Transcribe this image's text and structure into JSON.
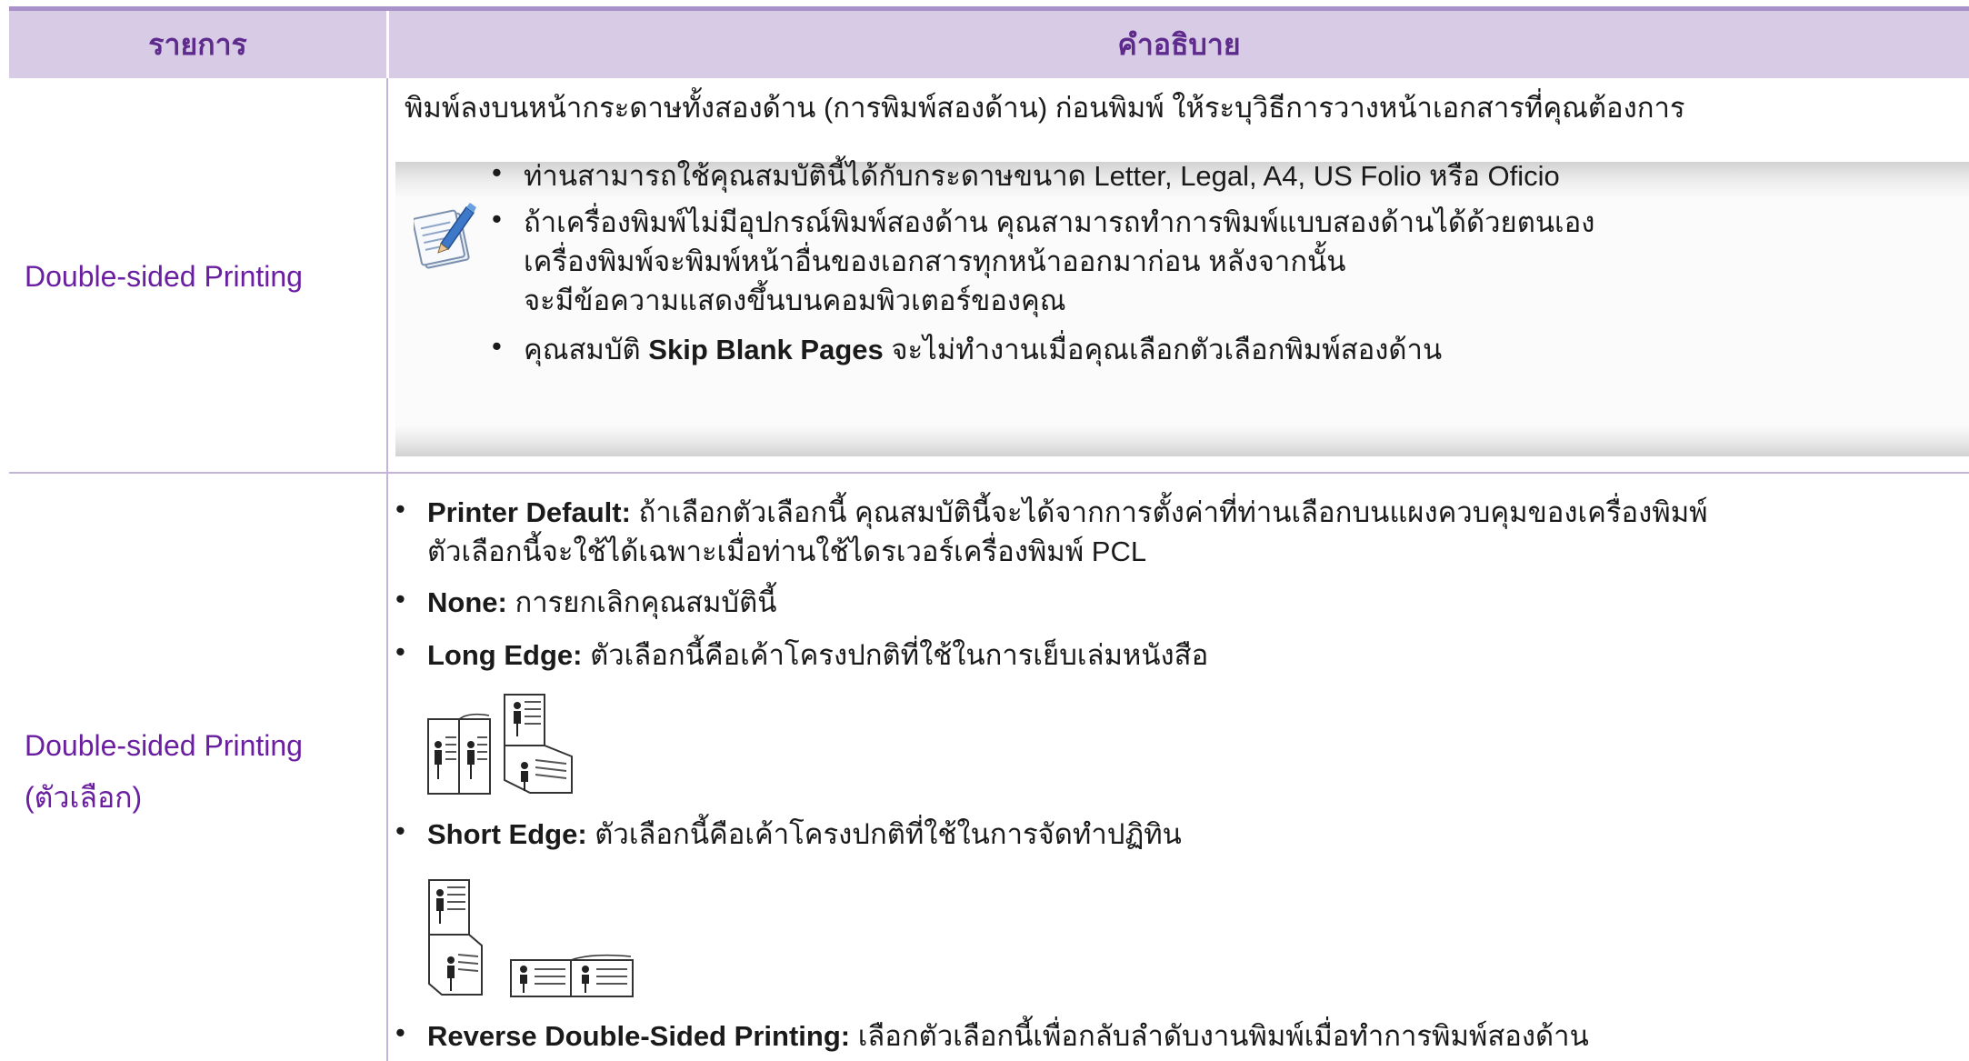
{
  "header": {
    "col1": "รายการ",
    "col2": "คำอธิบาย"
  },
  "row1": {
    "label": "Double-sided Printing",
    "intro": "พิมพ์ลงบนหน้ากระดาษทั้งสองด้าน (การพิมพ์สองด้าน) ก่อนพิมพ์ ให้ระบุวิธีการวางหน้าเอกสารที่คุณต้องการ",
    "note": {
      "icon": "note-pencil-icon",
      "items": [
        "ท่านสามารถใช้คุณสมบัตินี้ได้กับกระดาษขนาด Letter, Legal, A4, US Folio หรือ Oficio",
        "ถ้าเครื่องพิมพ์ไม่มีอุปกรณ์พิมพ์สองด้าน คุณสามารถทำการพิมพ์แบบสองด้านได้ด้วยตนเอง",
        "เครื่องพิมพ์จะพิมพ์หน้าอื่นของเอกสารทุกหน้าออกมาก่อน หลังจากนั้น",
        "จะมีข้อความแสดงขึ้นบนคอมพิวเตอร์ของคุณ"
      ],
      "item3_prefix": "คุณสมบัติ",
      "item3_bold": "Skip Blank Pages",
      "item3_suffix": "จะไม่ทำงานเมื่อคุณเลือกตัวเลือกพิมพ์สองด้าน"
    }
  },
  "row2": {
    "label_line1": "Double-sided Printing",
    "label_line2": "(ตัวเลือก)",
    "options": [
      {
        "name": "Printer Default:",
        "text": "ถ้าเลือกตัวเลือกนี้ คุณสมบัตินี้จะได้จากการตั้งค่าที่ท่านเลือกบนแผงควบคุมของเครื่องพิมพ์",
        "text2": "ตัวเลือกนี้จะใช้ได้เฉพาะเมื่อท่านใช้ไดรเวอร์เครื่องพิมพ์ PCL"
      },
      {
        "name": "None:",
        "text": "การยกเลิกคุณสมบัตินี้"
      },
      {
        "name": "Long Edge:",
        "text": "ตัวเลือกนี้คือเค้าโครงปกติที่ใช้ในการเย็บเล่มหนังสือ"
      },
      {
        "name": "Short Edge:",
        "text": "ตัวเลือกนี้คือเค้าโครงปกติที่ใช้ในการจัดทำปฏิทิน"
      },
      {
        "name": "Reverse Double-Sided Printing:",
        "text": "เลือกตัวเลือกนี้เพื่อกลับลำดับงานพิมพ์เมื่อทำการพิมพ์สองด้าน"
      }
    ],
    "bullet": "•"
  }
}
